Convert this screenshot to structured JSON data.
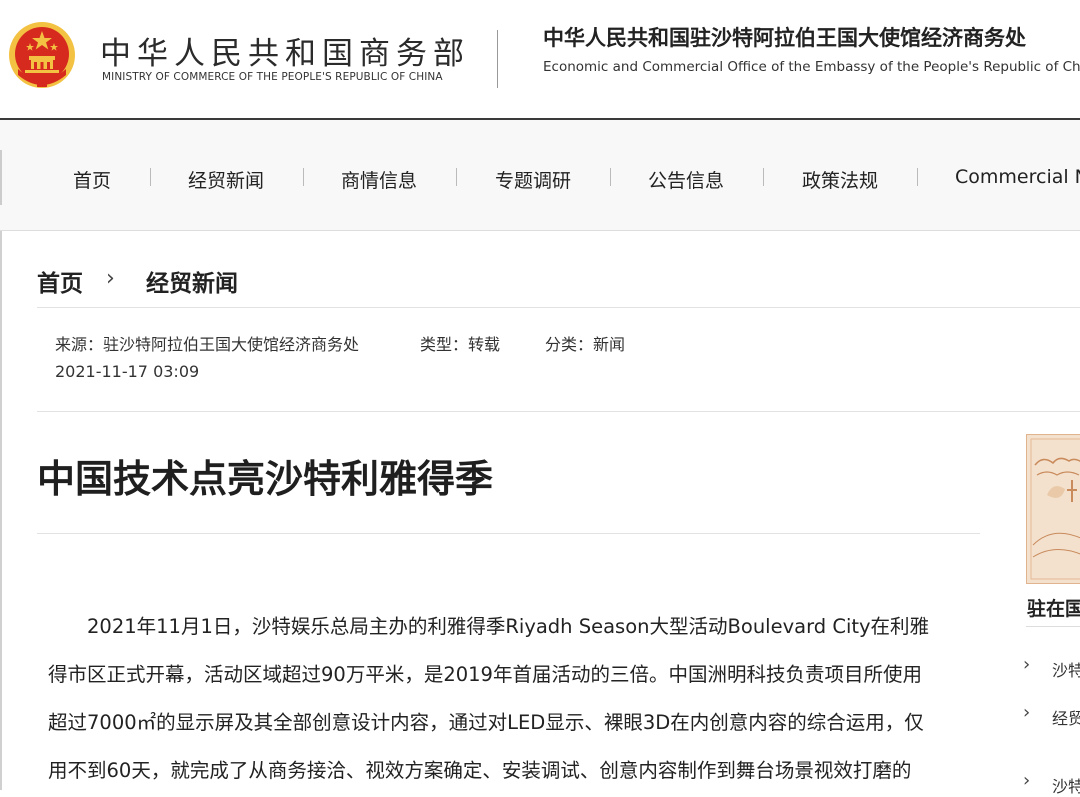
{
  "header": {
    "ministry_cn": "中华人民共和国商务部",
    "ministry_en": "MINISTRY OF COMMERCE OF THE PEOPLE'S REPUBLIC OF CHINA",
    "office_cn": "中华人民共和国驻沙特阿拉伯王国大使馆经济商务处",
    "office_en": "Economic and Commercial Office of the Embassy of the People's Republic of China"
  },
  "nav": {
    "items": [
      {
        "label": "首页"
      },
      {
        "label": "经贸新闻"
      },
      {
        "label": "商情信息"
      },
      {
        "label": "专题调研"
      },
      {
        "label": "公告信息"
      },
      {
        "label": "政策法规"
      },
      {
        "label": "Commercial N"
      }
    ]
  },
  "breadcrumb": {
    "home": "首页",
    "separator": "›",
    "current": "经贸新闻"
  },
  "meta": {
    "source": "来源：驻沙特阿拉伯王国大使馆经济商务处",
    "type": "类型：转载",
    "category": "分类：新闻",
    "date": "2021-11-17 03:09"
  },
  "article": {
    "title": "中国技术点亮沙特利雅得季",
    "lines": [
      "　　2021年11月1日，沙特娱乐总局主办的利雅得季Riyadh Season大型活动Boulevard City在利雅",
      "得市区正式开幕，活动区域超过90万平米，是2019年首届活动的三倍。中国洲明科技负责项目所使用",
      "超过7000㎡的显示屏及其全部创意设计内容，通过对LED显示、裸眼3D在内创意内容的综合运用，仅",
      "用不到60天，就完成了从商务接洽、视效方案确定、安装调试、创意内容制作到舞台场景视效打磨的"
    ]
  },
  "sidebar": {
    "heading": "驻在国",
    "items": [
      {
        "label": "沙特"
      },
      {
        "label": "经贸"
      },
      {
        "label": "沙特"
      }
    ]
  },
  "colors": {
    "emblem_red": "#d62a1e",
    "emblem_gold": "#f3c242",
    "header_rule": "#3a3a3a",
    "nav_bg": "#f8f8f8"
  }
}
